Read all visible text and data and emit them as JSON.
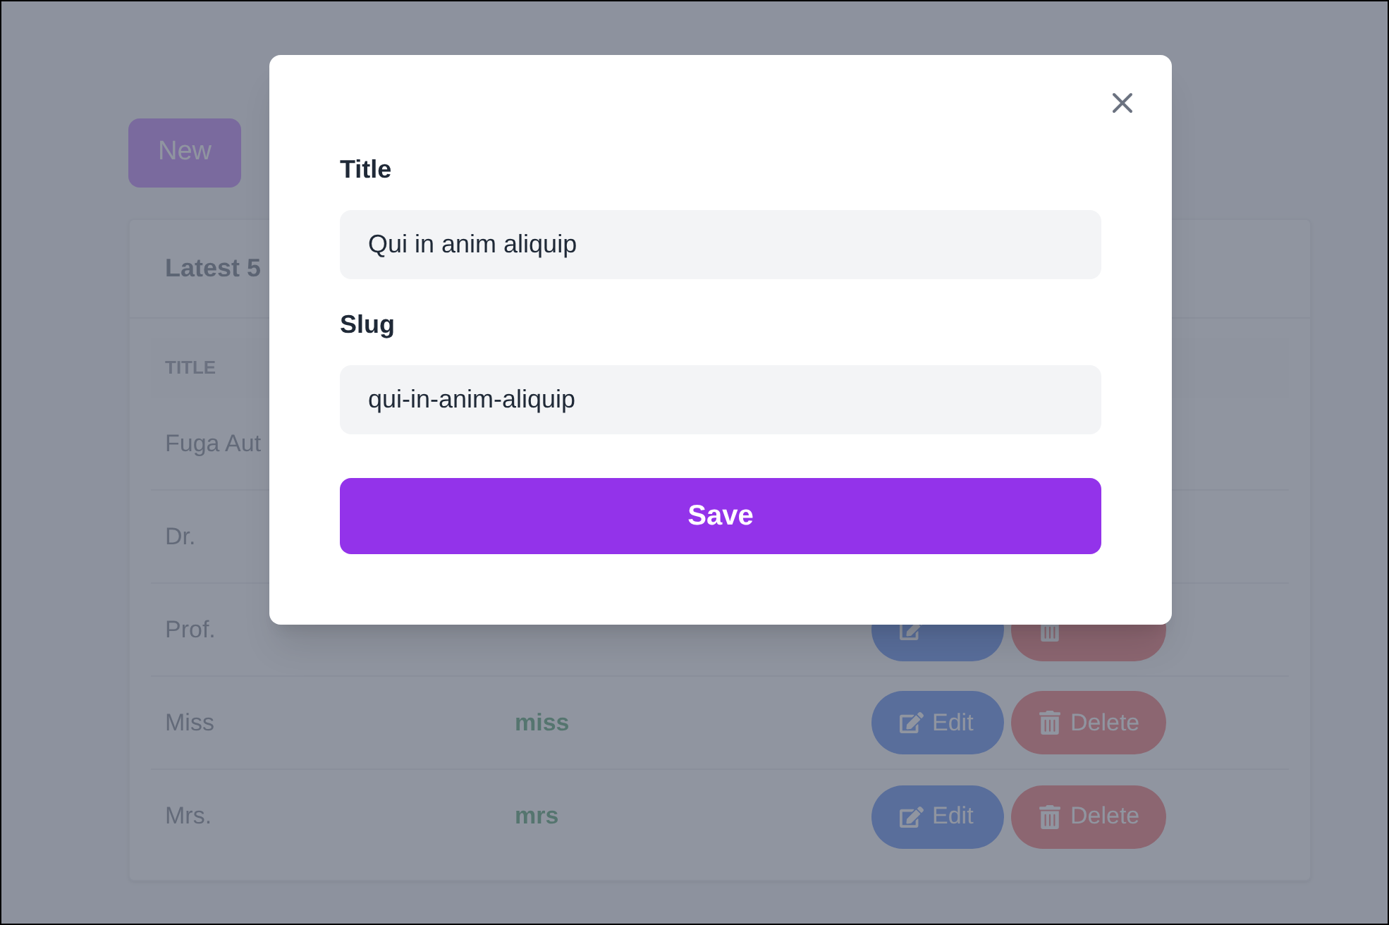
{
  "page": {
    "new_button": "New"
  },
  "card": {
    "title": "Latest 5",
    "columns": [
      "TITLE"
    ],
    "rows": [
      {
        "title": "Fuga Aut"
      },
      {
        "title": "Dr."
      },
      {
        "title": "Prof.",
        "actions": [
          {
            "kind": "edit"
          },
          {
            "kind": "delete"
          }
        ]
      },
      {
        "title": "Miss",
        "slug": "miss",
        "actions": [
          {
            "kind": "edit",
            "label": "Edit"
          },
          {
            "kind": "delete",
            "label": "Delete"
          }
        ]
      },
      {
        "title": "Mrs.",
        "slug": "mrs",
        "actions": [
          {
            "kind": "edit",
            "label": "Edit"
          },
          {
            "kind": "delete",
            "label": "Delete"
          }
        ]
      }
    ]
  },
  "modal": {
    "fields": [
      {
        "label": "Title",
        "value": "Qui in anim aliquip"
      },
      {
        "label": "Slug",
        "value": "qui-in-anim-aliquip"
      }
    ],
    "submit": "Save"
  }
}
